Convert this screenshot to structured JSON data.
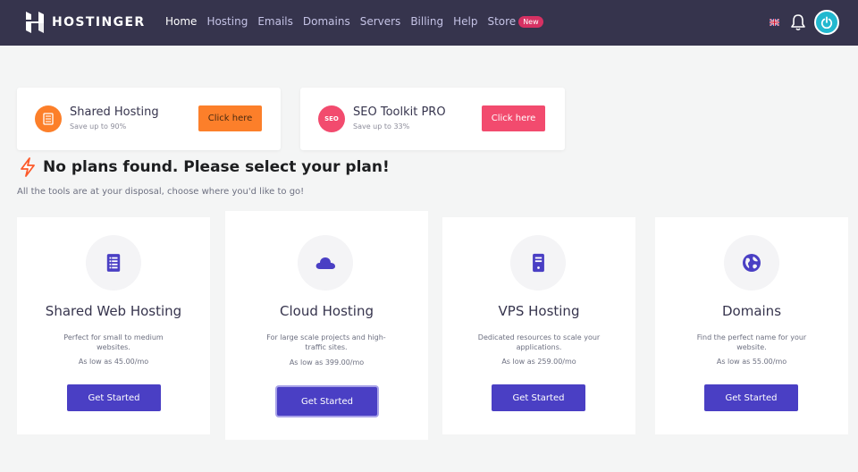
{
  "brand": {
    "name": "HOSTINGER"
  },
  "nav": {
    "items": [
      {
        "label": "Home",
        "active": true
      },
      {
        "label": "Hosting"
      },
      {
        "label": "Emails"
      },
      {
        "label": "Domains"
      },
      {
        "label": "Servers"
      },
      {
        "label": "Billing"
      },
      {
        "label": "Help"
      },
      {
        "label": "Store"
      }
    ],
    "store_badge": "New",
    "icons": [
      "uk-flag-icon",
      "bell-icon",
      "power-icon"
    ]
  },
  "promos": [
    {
      "title": "Shared Hosting",
      "subtitle": "Save up to 90%",
      "button": "Click here",
      "color": "#fc7f2a",
      "icon": "server-icon"
    },
    {
      "title": "SEO Toolkit PRO",
      "subtitle": "Save up to 33%",
      "button": "Click here",
      "color": "#f24b6e",
      "icon_text": "SEO"
    }
  ],
  "main": {
    "heading": "No plans found. Please select your plan!",
    "subheading": "All the tools are at your disposal, choose where you'd like to go!"
  },
  "plans": [
    {
      "title": "Shared Web Hosting",
      "desc": "Perfect for small to medium websites.",
      "price": "As low as 45.00/mo",
      "button": "Get Started",
      "icon": "shared-hosting-icon"
    },
    {
      "title": "Cloud Hosting",
      "desc": "For large scale projects and high-traffic sites.",
      "price": "As low as 399.00/mo",
      "button": "Get Started",
      "icon": "cloud-icon"
    },
    {
      "title": "VPS Hosting",
      "desc": "Dedicated resources to scale your applications.",
      "price": "As low as 259.00/mo",
      "button": "Get Started",
      "icon": "vps-server-icon"
    },
    {
      "title": "Domains",
      "desc": "Find the perfect name for your website.",
      "price": "As low as 55.00/mo",
      "button": "Get Started",
      "icon": "globe-icon"
    }
  ],
  "colors": {
    "nav_bg": "#36344d",
    "accent": "#4a3fc4",
    "page_bg": "#f4f5f5"
  }
}
